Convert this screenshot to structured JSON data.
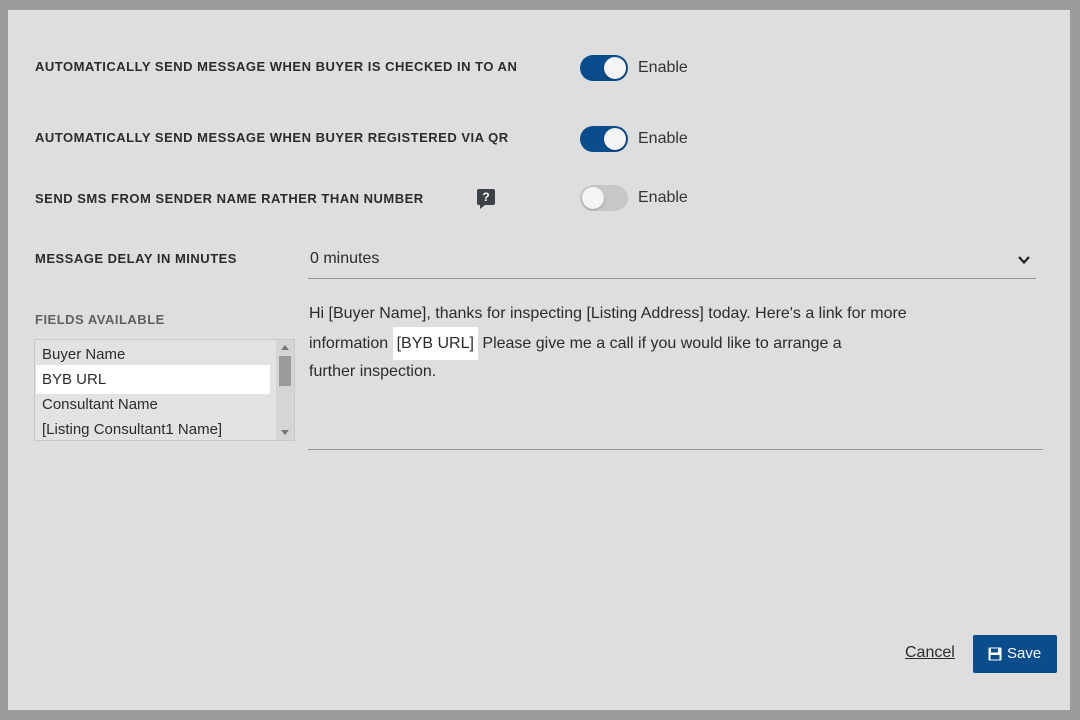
{
  "settings": {
    "auto_checkin": {
      "label": "AUTOMATICALLY SEND MESSAGE WHEN BUYER IS CHECKED IN TO AN",
      "enabled": true,
      "toggle_label": "Enable"
    },
    "auto_qr": {
      "label": "AUTOMATICALLY SEND MESSAGE WHEN BUYER REGISTERED VIA QR",
      "enabled": true,
      "toggle_label": "Enable"
    },
    "sender_name": {
      "label": "SEND SMS FROM SENDER NAME RATHER THAN NUMBER",
      "enabled": false,
      "toggle_label": "Enable",
      "help_icon": "?"
    }
  },
  "delay": {
    "label": "MESSAGE DELAY IN MINUTES",
    "value": "0 minutes"
  },
  "fields": {
    "label": "FIELDS AVAILABLE",
    "items": [
      "Buyer Name",
      "BYB URL",
      "Consultant Name",
      "[Listing Consultant1 Name]"
    ],
    "selected": "BYB URL"
  },
  "message": {
    "line1": "Hi [Buyer Name], thanks for inspecting [Listing Address] today. Here's a link for more",
    "line2_pre": "information ",
    "line2_token": "[BYB URL]",
    "line2_post": " Please give me a call if you would like to arrange a",
    "line3": "further inspection."
  },
  "footer": {
    "cancel": "Cancel",
    "save": "Save"
  },
  "colors": {
    "primary": "#0a4d8c",
    "background": "#dedede"
  }
}
